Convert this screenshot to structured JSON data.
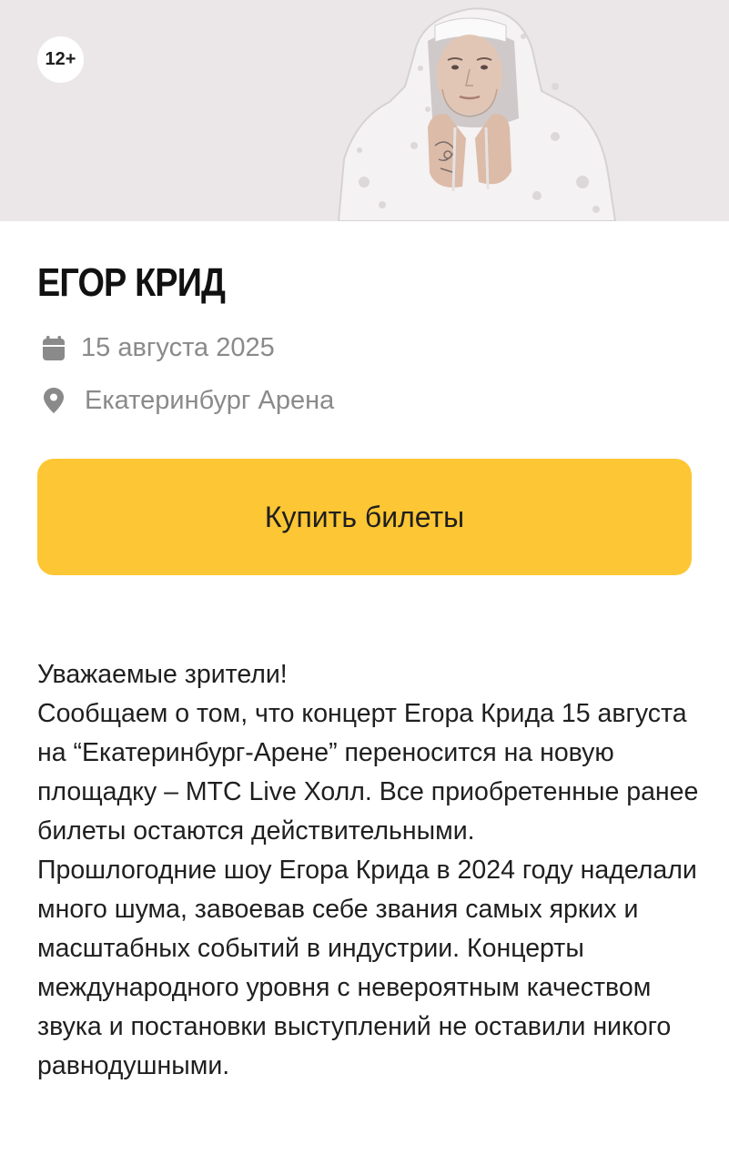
{
  "hero": {
    "age_rating": "12+",
    "image_alt": "artist-photo"
  },
  "event": {
    "title": "ЕГОР КРИД",
    "date": "15 августа 2025",
    "venue": "Екатеринбург Арена"
  },
  "actions": {
    "buy_label": "Купить билеты"
  },
  "description": {
    "paragraphs": [
      "Уважаемые зрители!",
      "Сообщаем о том, что концерт Егора Крида 15 августа на “Екатеринбург-Арене” переносится на новую площадку – МТС Live Холл. Все приобретенные ранее билеты остаются действительными.",
      "Прошлогодние шоу Егора Крида в 2024 году наделали много шума, завоевав себе звания самых ярких и масштабных событий в индустрии. Концерты международного уровня с невероятным качеством звука и постановки выступлений не оставили никого равнодушными."
    ]
  },
  "icons": {
    "date": "calendar-icon",
    "venue": "location-pin-icon"
  },
  "colors": {
    "accent": "#fdc634",
    "hero_background": "#ebe7e8",
    "meta_text": "#8a8a8a",
    "body_text": "#1f1f1f"
  }
}
